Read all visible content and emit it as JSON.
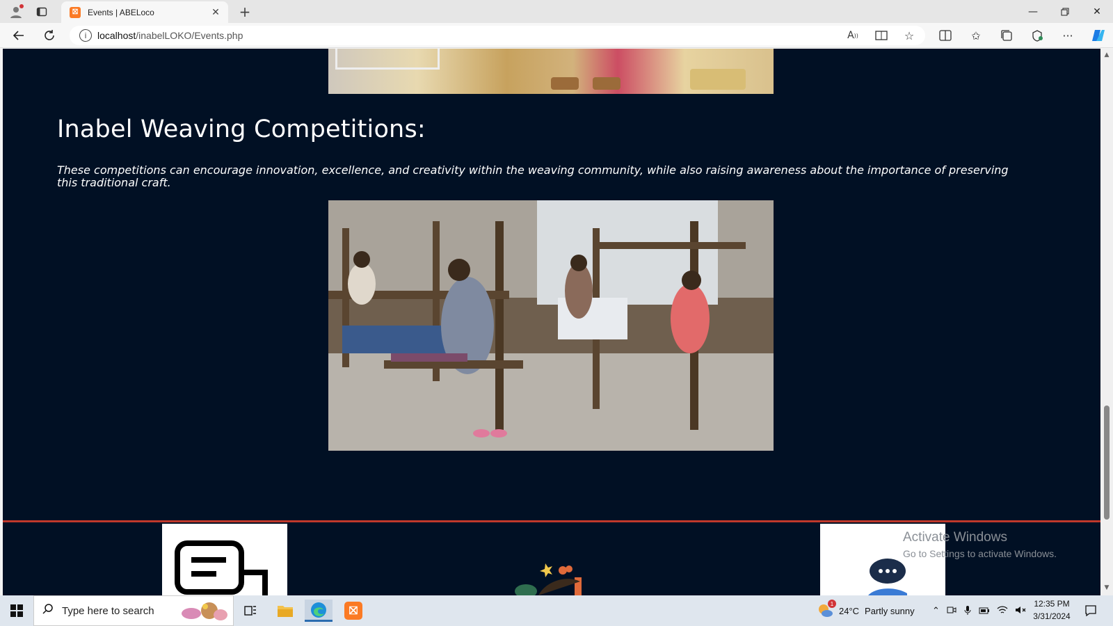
{
  "browser": {
    "tab_title": "Events | ABELoco",
    "favicon_glyph": "⛝",
    "url_host": "localhost",
    "url_path": "/inabelLOKO/Events.php"
  },
  "page": {
    "heading": "Inabel Weaving Competitions:",
    "description": "These competitions can encourage innovation, excellence, and creativity within the weaving community, while also raising awareness about the importance of preserving this traditional craft."
  },
  "watermark": {
    "title": "Activate Windows",
    "subtitle": "Go to Settings to activate Windows."
  },
  "taskbar": {
    "search_placeholder": "Type here to search",
    "weather_temp": "24°C",
    "weather_desc": "Partly sunny",
    "weather_badge": "1",
    "time": "12:35 PM",
    "date": "3/31/2024"
  },
  "colors": {
    "page_bg": "#011024",
    "footer_accent": "#c0392b"
  }
}
